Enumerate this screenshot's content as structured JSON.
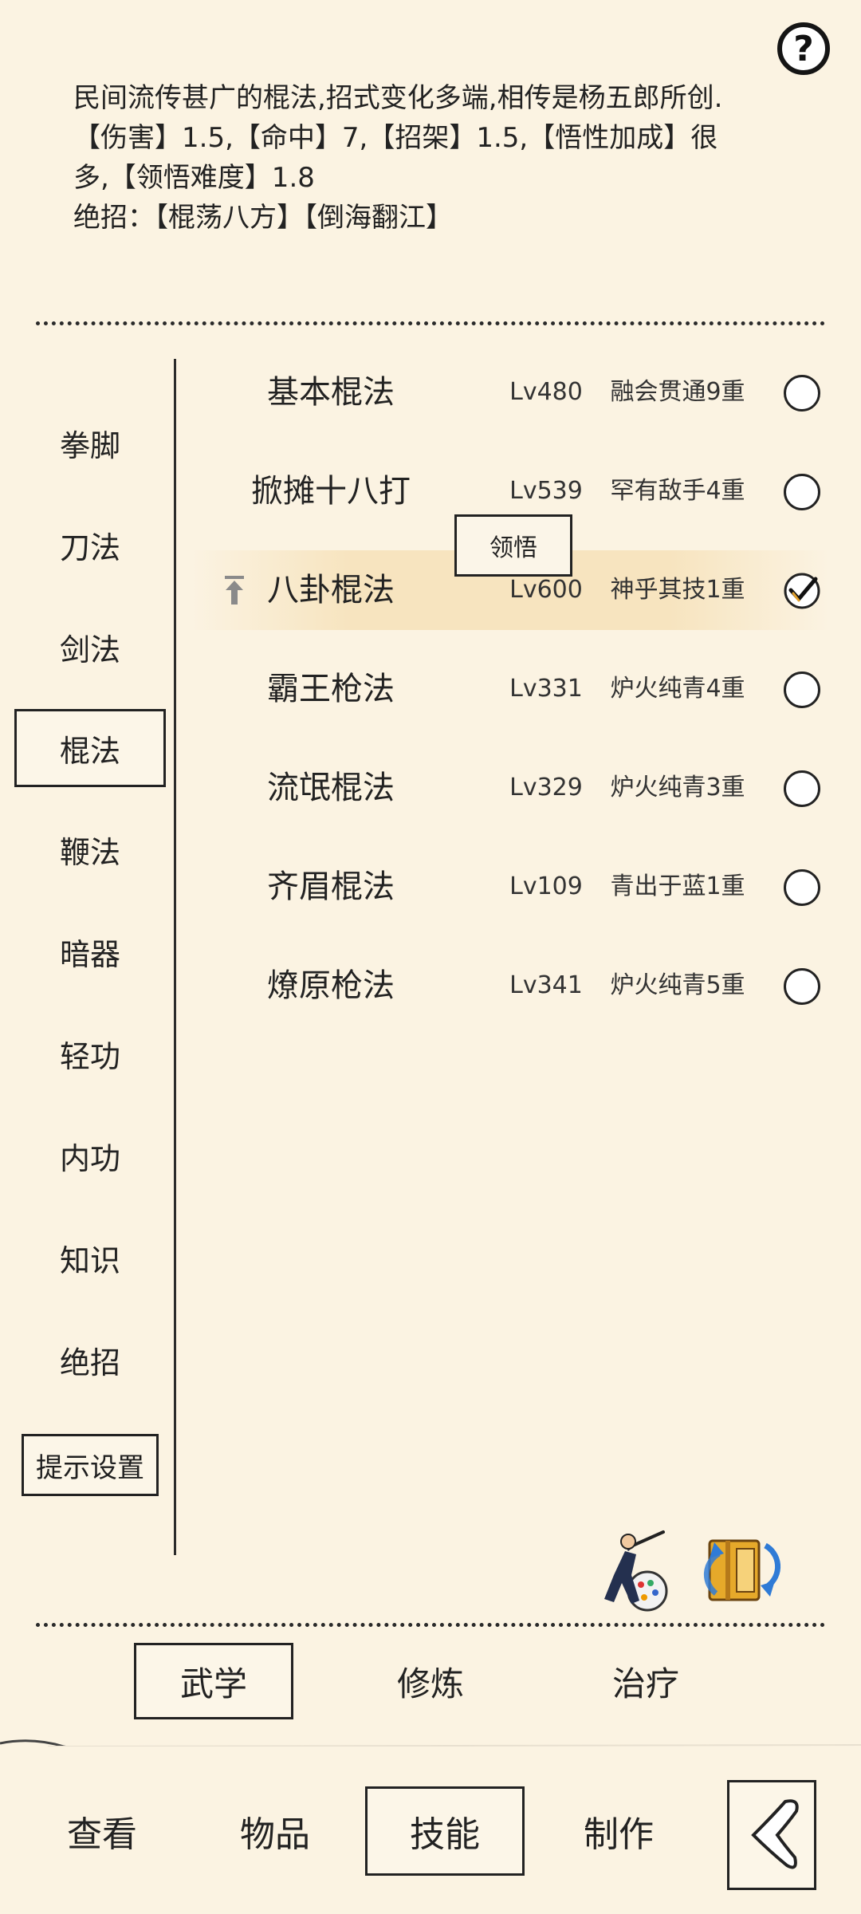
{
  "description": {
    "line1": "民间流传甚广的棍法,招式变化多端,相传是杨五郎所创.",
    "line2": "【伤害】1.5,【命中】7,【招架】1.5,【悟性加成】很",
    "line3": "多,【领悟难度】1.8",
    "line4": "绝招：【棍荡八方】【倒海翻江】"
  },
  "categories": [
    {
      "label": "拳脚"
    },
    {
      "label": "刀法"
    },
    {
      "label": "剑法"
    },
    {
      "label": "棍法"
    },
    {
      "label": "鞭法"
    },
    {
      "label": "暗器"
    },
    {
      "label": "轻功"
    },
    {
      "label": "内功"
    },
    {
      "label": "知识"
    },
    {
      "label": "绝招"
    }
  ],
  "active_category": "棍法",
  "hint_settings_label": "提示设置",
  "skills": [
    {
      "name": "基本棍法",
      "level": "Lv480",
      "rank": "融会贯通9重",
      "selected": false
    },
    {
      "name": "掀摊十八打",
      "level": "Lv539",
      "rank": "罕有敌手4重",
      "selected": false
    },
    {
      "name": "八卦棍法",
      "level": "Lv600",
      "rank": "神乎其技1重",
      "selected": true
    },
    {
      "name": "霸王枪法",
      "level": "Lv331",
      "rank": "炉火纯青4重",
      "selected": false
    },
    {
      "name": "流氓棍法",
      "level": "Lv329",
      "rank": "炉火纯青3重",
      "selected": false
    },
    {
      "name": "齐眉棍法",
      "level": "Lv109",
      "rank": "青出于蓝1重",
      "selected": false
    },
    {
      "name": "燎原枪法",
      "level": "Lv341",
      "rank": "炉火纯青5重",
      "selected": false
    }
  ],
  "tooltip_label": "领悟",
  "subtabs": [
    {
      "label": "武学"
    },
    {
      "label": "修炼"
    },
    {
      "label": "治疗"
    }
  ],
  "active_subtab": "武学",
  "bottom_nav": [
    {
      "label": "查看"
    },
    {
      "label": "物品"
    },
    {
      "label": "技能"
    },
    {
      "label": "制作"
    }
  ],
  "active_bottom_nav": "技能",
  "icons": {
    "help": "help-icon",
    "ninja": "ninja-skin-icon",
    "book_swap": "book-swap-icon",
    "back": "back-arrow-icon",
    "up": "pin-top-icon",
    "check": "checkmark-icon"
  },
  "colors": {
    "background": "#fbf3e2",
    "highlight_row": "#f7e4bf",
    "border": "#222222"
  }
}
